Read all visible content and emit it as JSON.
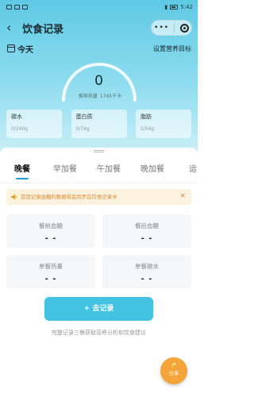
{
  "status_bar": {
    "time": "5:42"
  },
  "navbar": {
    "title": "饮食记录",
    "back_icon": "chevron-left-icon",
    "more_icon": "more-dots-icon",
    "target_icon": "target-icon"
  },
  "date_row": {
    "date_label": "今天",
    "goal_link": "设置营养目标"
  },
  "summary": {
    "calories_value": "0",
    "recommended_label": "推荐热量",
    "recommended_value": "1745千卡",
    "gauge_color": "#ffffff"
  },
  "nutrients": [
    {
      "label": "碳水",
      "value": "0/240g"
    },
    {
      "label": "蛋白质",
      "value": "0/74g"
    },
    {
      "label": "脂肪",
      "value": "0/54g"
    }
  ],
  "meal_tabs": [
    {
      "label": "晚餐",
      "active": true
    },
    {
      "label": "早加餐",
      "active": false
    },
    {
      "label": "午加餐",
      "active": false
    },
    {
      "label": "晚加餐",
      "active": false
    },
    {
      "label": "运",
      "active": false
    }
  ],
  "notice": {
    "text": "首页记录血糖的数据将会同步在饮食记录中",
    "close": "×",
    "color": "#d88a2a"
  },
  "metrics": [
    {
      "label": "餐前血糖",
      "value": "- -"
    },
    {
      "label": "餐后血糖",
      "value": "- -"
    },
    {
      "label": "单餐热量",
      "value": "- -"
    },
    {
      "label": "单餐碳水",
      "value": "- -"
    }
  ],
  "record_button": {
    "label": "+ 去记录",
    "color": "#43c1e3"
  },
  "hint": "完整记录三餐获取营养分析和饮食建议",
  "share": {
    "label": "分享",
    "icon": "share-arrow-icon",
    "color": "#f5a43a"
  },
  "colors": {
    "header_top": "#5ec9e4",
    "accent": "#1b9fd6"
  }
}
